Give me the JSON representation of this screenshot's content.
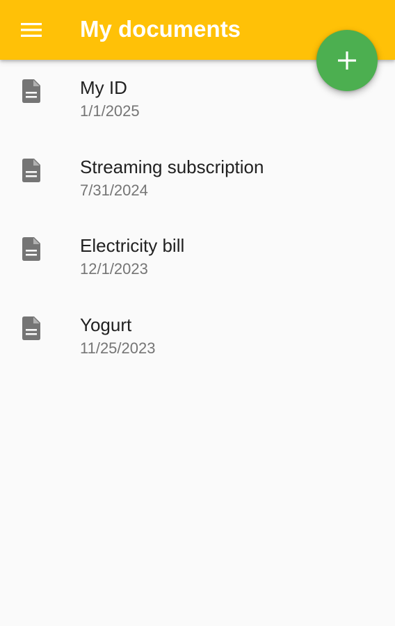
{
  "app_bar": {
    "title": "My documents",
    "menu_icon": "menu-icon",
    "color": "#FFC107"
  },
  "fab": {
    "icon": "plus-icon",
    "color": "#4CAF50"
  },
  "documents": [
    {
      "name": "My ID",
      "date": "1/1/2025",
      "icon": "document-icon"
    },
    {
      "name": "Streaming subscription",
      "date": "7/31/2024",
      "icon": "document-icon"
    },
    {
      "name": "Electricity bill",
      "date": "12/1/2023",
      "icon": "document-icon"
    },
    {
      "name": "Yogurt",
      "date": "11/25/2023",
      "icon": "document-icon"
    }
  ]
}
